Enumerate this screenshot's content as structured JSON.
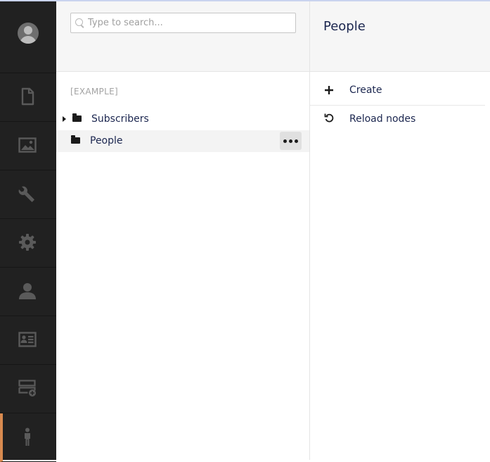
{
  "search": {
    "placeholder": "Type to search..."
  },
  "nav": {
    "items": [
      {
        "icon": "document-icon",
        "section": "content"
      },
      {
        "icon": "image-icon",
        "section": "media"
      },
      {
        "icon": "wrench-icon",
        "section": "developer"
      },
      {
        "icon": "gear-icon",
        "section": "settings"
      },
      {
        "icon": "user-icon",
        "section": "users"
      },
      {
        "icon": "id-card-icon",
        "section": "members"
      },
      {
        "icon": "server-add-icon",
        "section": "forms"
      },
      {
        "icon": "person-standing-icon",
        "section": "contacts",
        "active": true
      }
    ],
    "active_color": "#d88a4f"
  },
  "tree": {
    "root_label": "[EXAMPLE]",
    "nodes": [
      {
        "label": "Subscribers",
        "expandable": true
      },
      {
        "label": "People",
        "expandable": false,
        "selected": true
      }
    ]
  },
  "actions": {
    "title": "People",
    "items": [
      {
        "label": "Create",
        "icon": "plus-icon"
      },
      {
        "label": "Reload nodes",
        "icon": "reload-icon"
      }
    ]
  },
  "colors": {
    "nav_bg": "#212121",
    "header_bg": "#f6f6f6",
    "text": "#1b264f"
  }
}
